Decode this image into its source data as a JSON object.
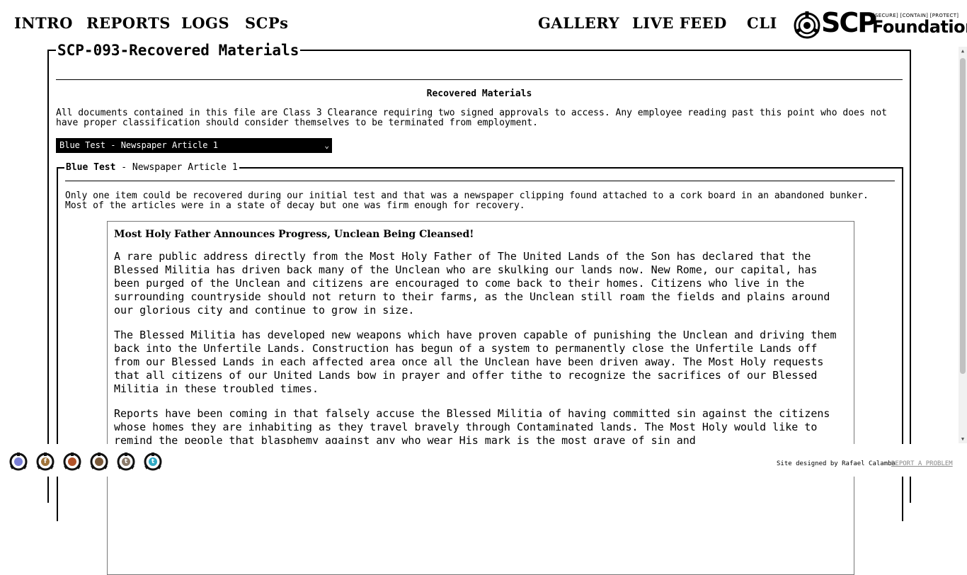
{
  "nav": {
    "left": [
      "INTRO",
      "REPORTS",
      "LOGS",
      "SCPs"
    ],
    "right": [
      "GALLERY",
      "LIVE FEED",
      "CLI"
    ]
  },
  "logo": {
    "scp": "SCP",
    "tagline": "[SECURE] [CONTAIN] [PROTECT]",
    "foundation": "Foundation"
  },
  "page": {
    "title": "SCP-093-Recovered Materials",
    "section_title": "Recovered Materials",
    "notice": "All documents contained in this file are Class 3 Clearance requiring two signed approvals to access. Any employee reading past this point who does not have proper classification should consider themselves to be terminated from employment."
  },
  "select": {
    "value": "Blue Test - Newspaper Article 1"
  },
  "record": {
    "legend_bold": "Blue Test",
    "legend_rest": " - Newspaper Article 1",
    "intro": "Only one item could be recovered during our initial test and that was a newspaper clipping found attached to a cork board in an abandoned bunker. Most of the articles were in a state of decay but one was firm enough for recovery."
  },
  "article": {
    "headline": "Most Holy Father Announces Progress, Unclean Being Cleansed!",
    "paragraphs": [
      "A rare public address directly from the Most Holy Father of The United Lands of the Son has declared that the Blessed Militia has driven back many of the Unclean who are skulking our lands now. New Rome, our capital, has been purged of the Unclean and citizens are encouraged to come back to their homes. Citizens who live in the surrounding countryside should not return to their farms, as the Unclean still roam the fields and plains around our glorious city and continue to grow in size.",
      "The Blessed Militia has developed new weapons which have proven capable of punishing the Unclean and driving them back into the Unfertile Lands. Construction has begun of a system to permanently close the Unfertile Lands off from our Blessed Lands in each affected area once all the Unclean have been driven away. The Most Holy requests that all citizens of our United Lands bow in prayer and offer tithe to recognize the sacrifices of our Blessed Militia in these troubled times.",
      "Reports have been coming in that falsely accuse the Blessed Militia of having committed sin against the citizens whose homes they are inhabiting as they travel bravely through Contaminated lands. The Most Holy would like to remind the people that blasphemy against any who wear His mark is the most grave of sin and"
    ]
  },
  "social": [
    {
      "icon": "discord-icon",
      "letter": "",
      "color": "#7a7fd6"
    },
    {
      "icon": "facebook-icon",
      "letter": "f",
      "color": "#a0743a"
    },
    {
      "icon": "reddit-icon",
      "letter": "",
      "color": "#b3542a"
    },
    {
      "icon": "wikidot-icon",
      "letter": "",
      "color": "#7a5a3a"
    },
    {
      "icon": "tumblr-icon",
      "letter": "t",
      "color": "#8a7a6a"
    },
    {
      "icon": "twitter-icon",
      "letter": "t",
      "color": "#2fa9c4"
    }
  ],
  "footer": {
    "credit": "Site designed by Rafael Calamba",
    "report": "REPORT A PROBLEM"
  }
}
